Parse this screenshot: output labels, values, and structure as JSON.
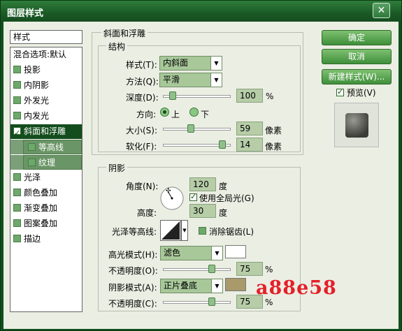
{
  "window": {
    "title": "图层样式",
    "close_glyph": "✕"
  },
  "left_panel": {
    "header": "样式",
    "items": [
      {
        "label": "混合选项:默认",
        "checkbox": "none"
      },
      {
        "label": "投影",
        "checkbox": "empty"
      },
      {
        "label": "内阴影",
        "checkbox": "empty"
      },
      {
        "label": "外发光",
        "checkbox": "empty"
      },
      {
        "label": "内发光",
        "checkbox": "empty"
      },
      {
        "label": "斜面和浮雕",
        "checkbox": "checked",
        "selected": true
      },
      {
        "label": "等高线",
        "checkbox": "empty",
        "sub": true
      },
      {
        "label": "纹理",
        "checkbox": "empty",
        "sub": true
      },
      {
        "label": "光泽",
        "checkbox": "empty"
      },
      {
        "label": "颜色叠加",
        "checkbox": "empty"
      },
      {
        "label": "渐变叠加",
        "checkbox": "empty"
      },
      {
        "label": "图案叠加",
        "checkbox": "empty"
      },
      {
        "label": "描边",
        "checkbox": "empty"
      }
    ]
  },
  "bevel": {
    "section_title": "斜面和浮雕",
    "structure_title": "结构",
    "style_label": "样式(T):",
    "style_value": "内斜面",
    "method_label": "方法(Q):",
    "method_value": "平滑",
    "depth_label": "深度(D):",
    "depth_value": "100",
    "depth_unit": "%",
    "depth_level": 0.1,
    "direction_label": "方向:",
    "dir_up": "上",
    "dir_down": "下",
    "size_label": "大小(S):",
    "size_value": "59",
    "size_unit": "像素",
    "size_level": 0.4,
    "soften_label": "软化(F):",
    "soften_value": "14",
    "soften_unit": "像素",
    "soften_level": 0.92
  },
  "shading": {
    "title": "阴影",
    "angle_label": "角度(N):",
    "angle_value": "120",
    "angle_unit": "度",
    "global_light_label": "使用全局光(G)",
    "altitude_label": "高度:",
    "altitude_value": "30",
    "altitude_unit": "度",
    "gloss_label": "光泽等高线:",
    "antialias_label": "消除锯齿(L)",
    "highlight_mode_label": "高光模式(H):",
    "highlight_mode_value": "滤色",
    "highlight_opacity_label": "不透明度(O):",
    "highlight_opacity_value": "75",
    "highlight_opacity_unit": "%",
    "highlight_opacity_level": 0.75,
    "shadow_mode_label": "阴影模式(A):",
    "shadow_mode_value": "正片叠底",
    "shadow_opacity_label": "不透明度(C):",
    "shadow_opacity_value": "75",
    "shadow_opacity_unit": "%",
    "shadow_opacity_level": 0.75,
    "highlight_color": "#ffffff",
    "shadow_color": "#a89a6a"
  },
  "buttons": {
    "ok": "确定",
    "cancel": "取消",
    "new_style": "新建样式(W)...",
    "preview": "预览(V)"
  },
  "watermark": "a88e58",
  "colors": {
    "accent": "#0f4f1c",
    "selection": "#134d1d"
  }
}
